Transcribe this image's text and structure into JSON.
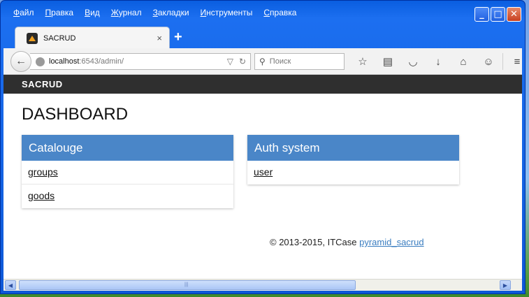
{
  "window": {
    "menu": [
      "Файл",
      "Правка",
      "Вид",
      "Журнал",
      "Закладки",
      "Инструменты",
      "Справка"
    ],
    "buttons": {
      "minimize": "_",
      "maximize": "□",
      "close": "✕"
    }
  },
  "tab": {
    "title": "SACRUD",
    "close": "×",
    "new_tab": "+"
  },
  "navbar": {
    "url_host": "localhost",
    "url_path": ":6543/admin/",
    "search_placeholder": "Поиск",
    "icons": [
      "star-icon",
      "reading-list-icon",
      "pocket-icon",
      "download-icon",
      "home-icon",
      "chat-icon",
      "menu-icon"
    ]
  },
  "app": {
    "brand": "SACRUD",
    "page_title": "DASHBOARD",
    "panels": [
      {
        "title": "Catalouge",
        "items": [
          "groups",
          "goods"
        ]
      },
      {
        "title": "Auth system",
        "items": [
          "user"
        ]
      }
    ],
    "footer_text": "© 2013-2015, ITCase ",
    "footer_link": "pyramid_sacrud"
  },
  "colors": {
    "panel_header": "#4a86c8",
    "appbar": "#2f2f2f",
    "link": "#3a7dc0"
  }
}
